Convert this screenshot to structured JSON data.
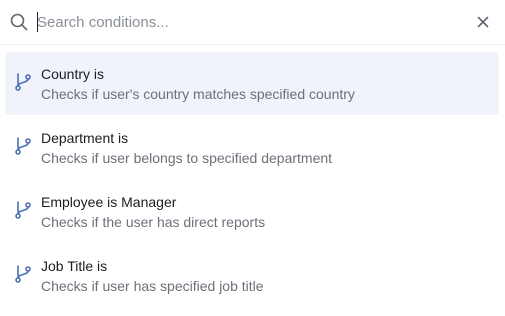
{
  "search": {
    "placeholder": "Search conditions...",
    "value": ""
  },
  "conditions": [
    {
      "title": "Country is",
      "description": "Checks if user's country matches specified country",
      "highlighted": true
    },
    {
      "title": "Department is",
      "description": "Checks if user belongs to specified department",
      "highlighted": false
    },
    {
      "title": "Employee is Manager",
      "description": "Checks if the user has direct reports",
      "highlighted": false
    },
    {
      "title": "Job Title is",
      "description": "Checks if user has specified job title",
      "highlighted": false
    }
  ],
  "icons": {
    "search": "search-icon",
    "close": "close-icon",
    "condition": "branch-icon"
  },
  "colors": {
    "highlight_background": "#f0f3f9",
    "icon_accent": "#4f6fb5",
    "title_text": "#1a1d21",
    "description_text": "#6b7079",
    "placeholder_text": "#8a9099"
  }
}
